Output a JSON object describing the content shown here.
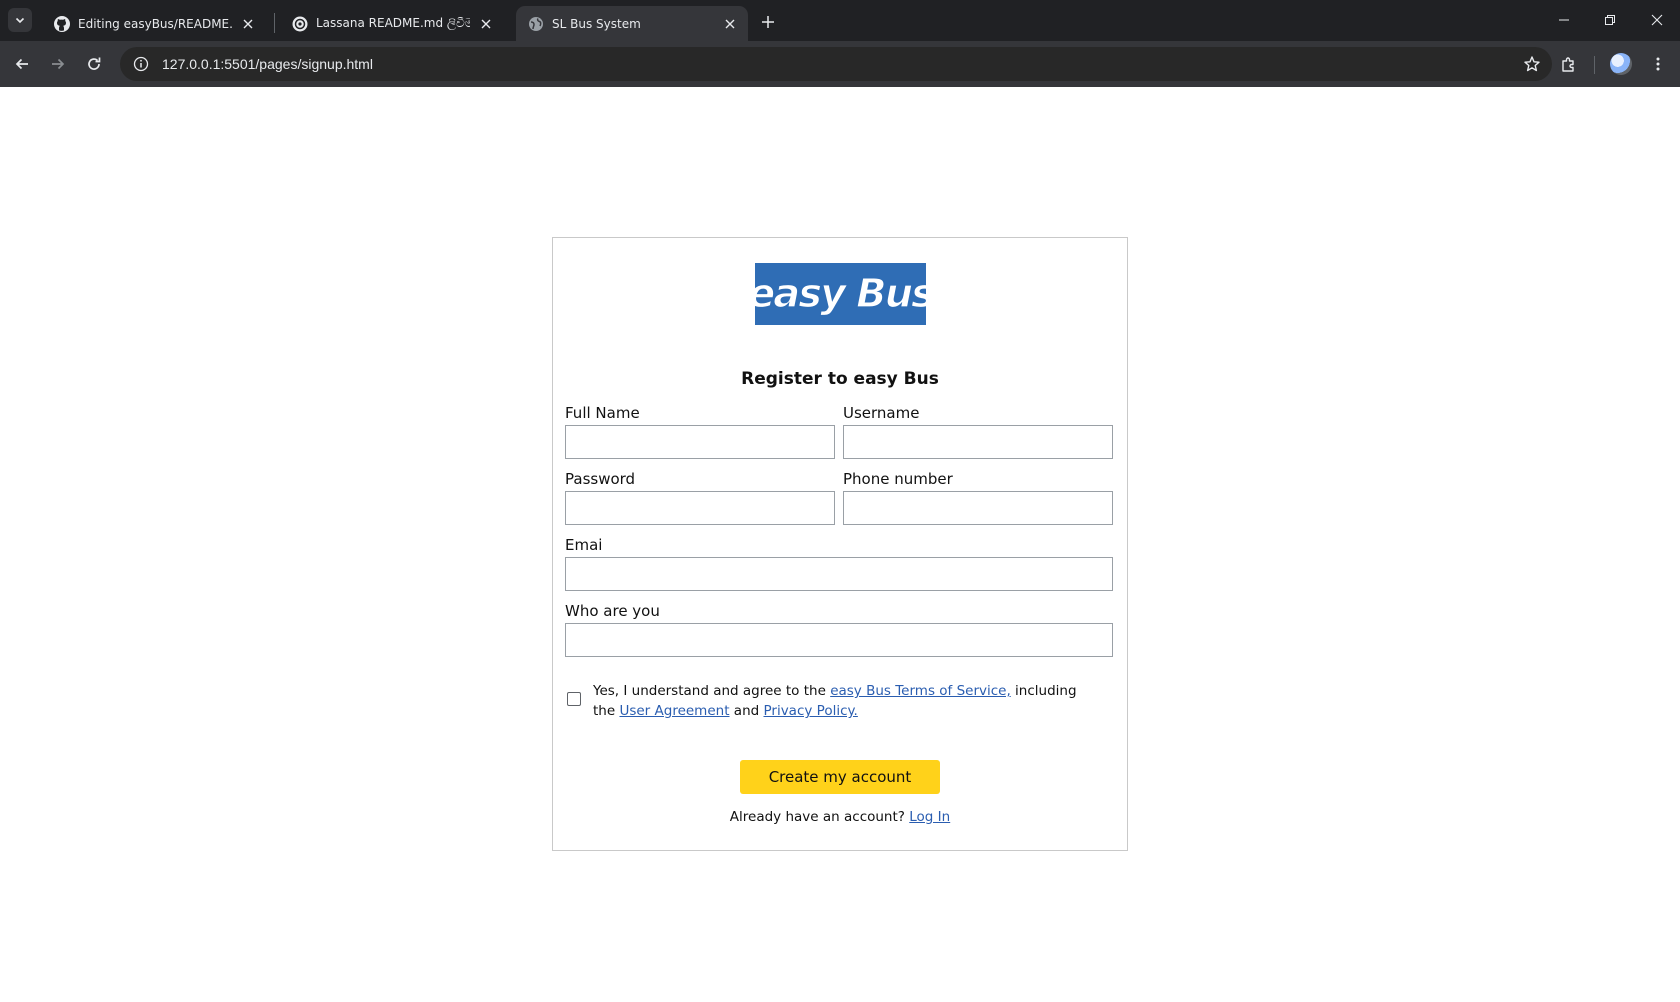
{
  "browser": {
    "tabs": [
      {
        "title": "Editing easyBus/README.md at",
        "favicon": "github-icon",
        "active": false
      },
      {
        "title": "Lassana README.md ලිවීම",
        "favicon": "chatgpt-icon",
        "active": false
      },
      {
        "title": "SL Bus System",
        "favicon": "globe-icon",
        "active": true
      }
    ],
    "url": "127.0.0.1:5501/pages/signup.html"
  },
  "page": {
    "logo_text": "easy Bus",
    "logo_color": "#2f6db5",
    "heading": "Register to easy Bus",
    "fields": {
      "full_name": {
        "label": "Full Name",
        "value": ""
      },
      "username": {
        "label": "Username",
        "value": ""
      },
      "password": {
        "label": "Password",
        "value": ""
      },
      "phone": {
        "label": "Phone number",
        "value": ""
      },
      "email": {
        "label": "Emai",
        "value": ""
      },
      "who": {
        "label": "Who are you",
        "value": ""
      }
    },
    "terms": {
      "checked": false,
      "prefix": "Yes, I understand and agree to the ",
      "tos_link": "easy Bus Terms of Service,",
      "middle": " including the ",
      "ua_link": "User Agreement",
      "and": " and ",
      "privacy_link": "Privacy Policy."
    },
    "submit_label": "Create my account",
    "submit_color": "#ffd21a",
    "login_prompt": "Already have an account? ",
    "login_link": "Log In"
  }
}
